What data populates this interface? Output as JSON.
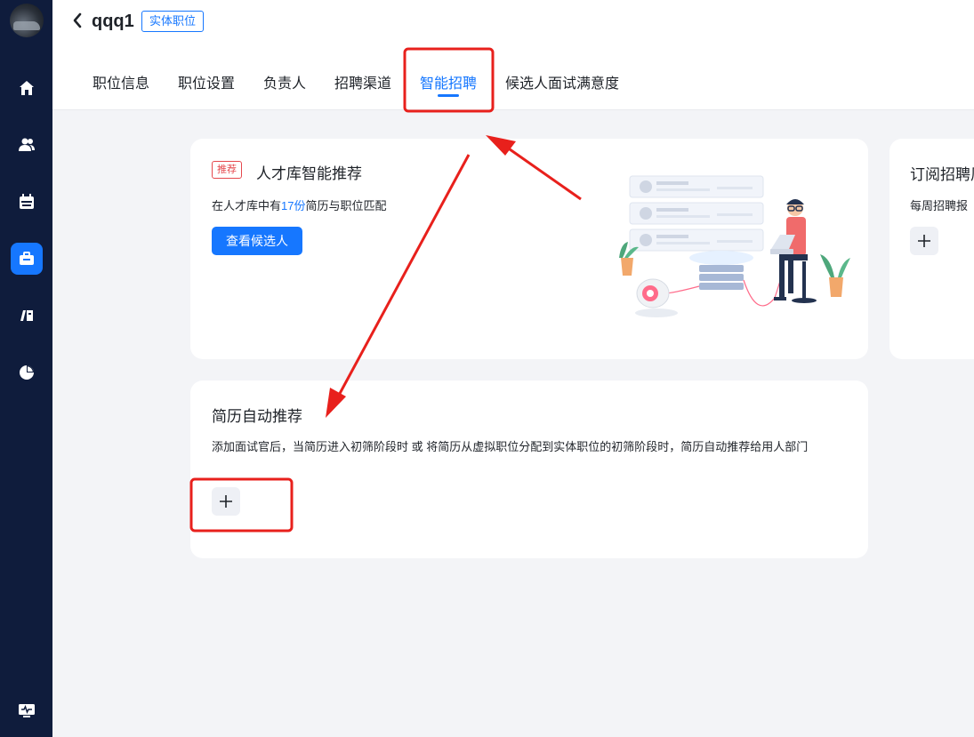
{
  "header": {
    "title": "qqq1",
    "job_type_tag": "实体职位",
    "tabs": [
      {
        "label": "职位信息"
      },
      {
        "label": "职位设置"
      },
      {
        "label": "负责人"
      },
      {
        "label": "招聘渠道"
      },
      {
        "label": "智能招聘",
        "active": true
      },
      {
        "label": "候选人面试满意度"
      }
    ]
  },
  "sidebar": {
    "items": [
      {
        "icon": "home-icon"
      },
      {
        "icon": "users-icon"
      },
      {
        "icon": "calendar-icon"
      },
      {
        "icon": "briefcase-icon",
        "active": true
      },
      {
        "icon": "book-icon"
      },
      {
        "icon": "pie-chart-icon"
      },
      {
        "icon": "monitor-icon"
      }
    ]
  },
  "talent_card": {
    "badge": "推荐",
    "title": "人才库智能推荐",
    "desc_prefix": "在人才库中有",
    "count": "17份",
    "desc_suffix": "简历与职位匹配",
    "button": "查看候选人"
  },
  "resume_card": {
    "title": "简历自动推荐",
    "description": "添加面试官后，当简历进入初筛阶段时 或 将简历从虚拟职位分配到实体职位的初筛阶段时，简历自动推荐给用人部门"
  },
  "subscribe_card": {
    "title": "订阅招聘周",
    "desc": "每周招聘报"
  },
  "colors": {
    "accent": "#1677ff",
    "sidebar": "#0f1c3c",
    "annotation": "#e8201c"
  }
}
